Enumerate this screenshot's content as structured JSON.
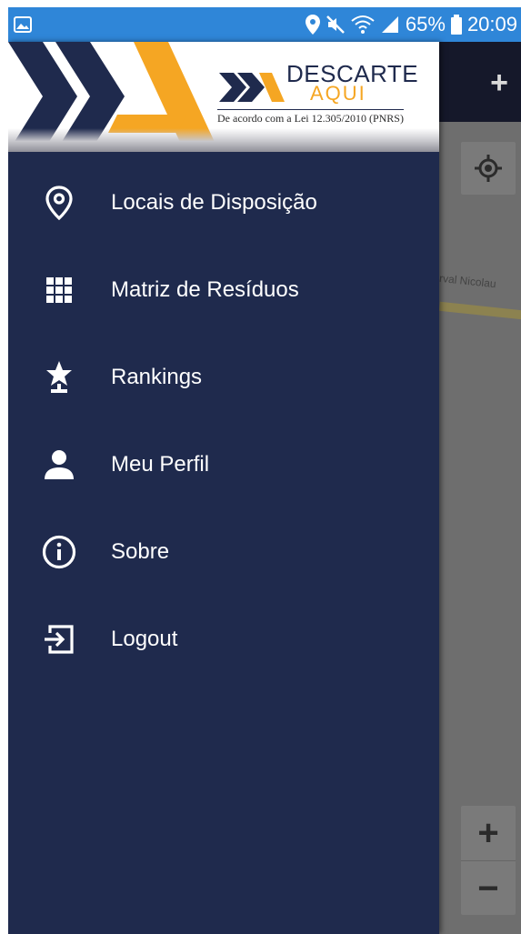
{
  "status_bar": {
    "battery": "65%",
    "time": "20:09"
  },
  "banner": {
    "brand_line1": "DESCARTE",
    "brand_line2": "AQUI",
    "caption": "De acordo com a Lei 12.305/2010 (PNRS)"
  },
  "menu": {
    "items": [
      {
        "label": "Locais de Disposição",
        "icon": "location-pin-icon"
      },
      {
        "label": "Matriz de Resíduos",
        "icon": "grid-icon"
      },
      {
        "label": "Rankings",
        "icon": "trophy-star-icon"
      },
      {
        "label": "Meu Perfil",
        "icon": "person-icon"
      },
      {
        "label": "Sobre",
        "icon": "info-icon"
      },
      {
        "label": "Logout",
        "icon": "logout-icon"
      }
    ]
  },
  "map": {
    "street_label": "rval Nicolau",
    "add_label": "+",
    "zoom_in_label": "+",
    "zoom_out_label": "−"
  },
  "colors": {
    "status_bar": "#2f86d8",
    "drawer_bg": "#1f2a4d",
    "accent_orange": "#f5a623",
    "map_toolbar": "#15182a"
  }
}
